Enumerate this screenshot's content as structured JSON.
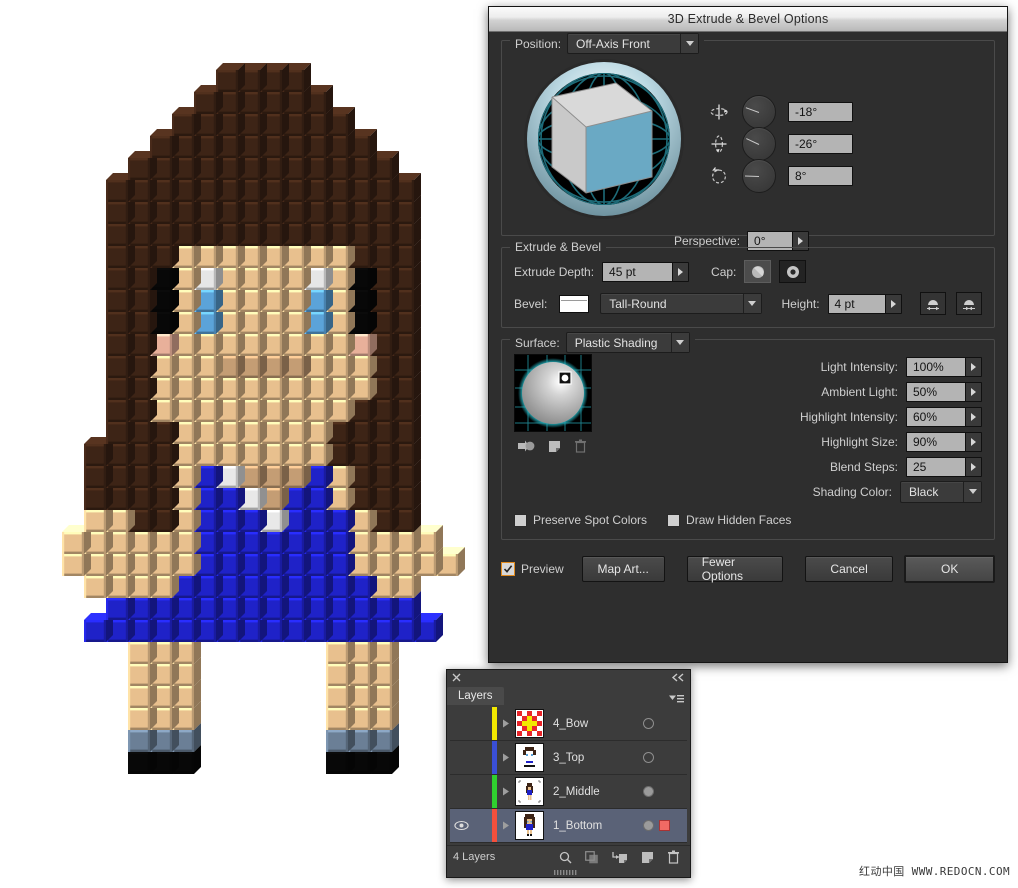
{
  "dialog": {
    "title": "3D Extrude & Bevel Options",
    "position": {
      "label": "Position:",
      "value": "Off-Axis Front",
      "rotations": [
        {
          "icon": "rotate-x-icon",
          "value": "-18°",
          "angle": 200
        },
        {
          "icon": "rotate-y-icon",
          "value": "-26°",
          "angle": 205
        },
        {
          "icon": "rotate-z-icon",
          "value": "8°",
          "angle": 182
        }
      ],
      "perspective_label": "Perspective:",
      "perspective_value": "0°"
    },
    "extrude": {
      "legend": "Extrude & Bevel",
      "depth_label": "Extrude Depth:",
      "depth_value": "45 pt",
      "cap_label": "Cap:",
      "cap_solid_icon": "cap-solid-icon",
      "cap_hollow_icon": "cap-hollow-icon",
      "bevel_label": "Bevel:",
      "bevel_value": "Tall-Round",
      "height_label": "Height:",
      "height_value": "4 pt",
      "bevel_out_icon": "bevel-extent-out-icon",
      "bevel_in_icon": "bevel-extent-in-icon"
    },
    "surface": {
      "legend": "Surface:",
      "value": "Plastic Shading",
      "sphere_icons": [
        "new-light-icon",
        "duplicate-light-icon",
        "delete-light-icon"
      ],
      "fields": [
        {
          "label": "Light Intensity:",
          "value": "100%"
        },
        {
          "label": "Ambient Light:",
          "value": "50%"
        },
        {
          "label": "Highlight Intensity:",
          "value": "60%"
        },
        {
          "label": "Highlight Size:",
          "value": "90%"
        },
        {
          "label": "Blend Steps:",
          "value": "25"
        }
      ],
      "shading_color_label": "Shading Color:",
      "shading_color_value": "Black",
      "preserve_spot_label": "Preserve Spot Colors",
      "draw_hidden_label": "Draw Hidden Faces"
    },
    "footer": {
      "preview_label": "Preview",
      "preview_checked": true,
      "map_art_label": "Map Art...",
      "fewer_options_label": "Fewer Options",
      "cancel_label": "Cancel",
      "ok_label": "OK"
    }
  },
  "layers_panel": {
    "tab_label": "Layers",
    "close_icon": "close-icon",
    "collapse_icon": "collapse-panel-icon",
    "menu_icon": "panel-menu-icon",
    "rows": [
      {
        "name": "4_Bow",
        "color": "#f2e900",
        "visible": false,
        "target": "open",
        "selected": false,
        "thumb": "bow-thumbnail"
      },
      {
        "name": "3_Top",
        "color": "#3a4fd6",
        "visible": false,
        "target": "open",
        "selected": false,
        "thumb": "top-thumbnail"
      },
      {
        "name": "2_Middle",
        "color": "#2fd02f",
        "visible": false,
        "target": "filled",
        "selected": false,
        "thumb": "middle-thumbnail"
      },
      {
        "name": "1_Bottom",
        "color": "#f4503c",
        "visible": true,
        "target": "filled",
        "selected": true,
        "thumb": "bottom-thumbnail"
      }
    ],
    "count_label": "4 Layers",
    "tools": [
      "locate-object-icon",
      "make-clipping-mask-icon",
      "create-sublayer-icon",
      "create-new-layer-icon",
      "delete-selection-icon"
    ]
  },
  "watermark": {
    "text": "红动中国 WWW.REDOCN.COM"
  },
  "artwork": {
    "name": "3d-extruded-pixel-girl",
    "colors": {
      "hair_dark": "#3d2416",
      "skin": "#e8c08e",
      "skin_shadow": "#c49d74",
      "blush": "#e8b09a",
      "eye_blue": "#5ba3d9",
      "eye_white": "#e6e6e6",
      "dress_blue": "#1f22c8",
      "black": "#080808",
      "white": "#e8e8e8",
      "sock_gray": "#6b7f96",
      "background": "#ffffff"
    }
  }
}
